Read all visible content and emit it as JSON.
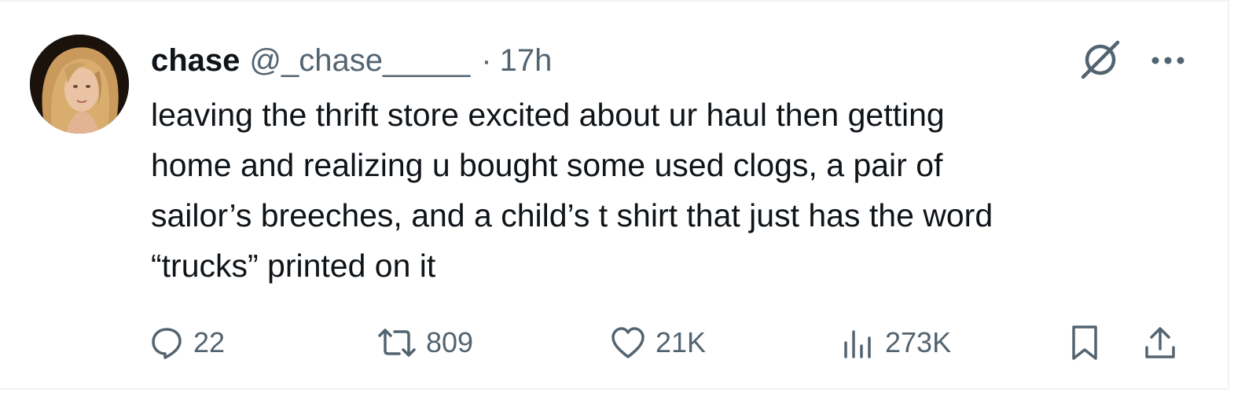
{
  "tweet": {
    "author": {
      "display_name": "chase",
      "handle": "@_chase_____",
      "avatar_icon": "profile-photo-avatar"
    },
    "separator": "·",
    "time": "17h",
    "text_lines": [
      "leaving the thrift store excited about ur haul then getting",
      "home and realizing u bought some used clogs, a pair of",
      "sailor’s breeches, and a child’s t shirt that just has the word",
      "“trucks” printed on it"
    ],
    "header_icons": [
      "grok-slash-icon",
      "more-dots-icon"
    ],
    "actions": {
      "replies": "22",
      "reposts": "809",
      "likes": "21K",
      "views": "273K"
    },
    "action_icons": [
      "reply-icon",
      "repost-icon",
      "like-icon",
      "views-icon",
      "bookmark-icon",
      "share-icon"
    ]
  },
  "colors": {
    "text_primary": "#0f1419",
    "text_secondary": "#536471",
    "border": "#eff3f4",
    "background": "#ffffff"
  }
}
